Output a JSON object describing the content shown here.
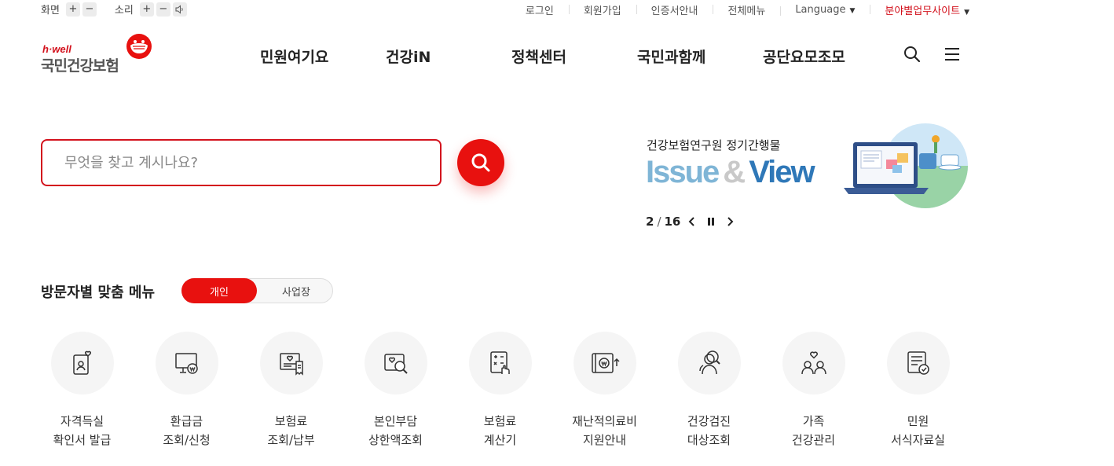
{
  "utility": {
    "screen_label": "화면",
    "sound_label": "소리",
    "plus": "+",
    "minus": "−",
    "links": [
      "로그인",
      "회원가입",
      "인증서안내",
      "전체메뉴",
      "Language"
    ],
    "site_link": "분야별업무사이트"
  },
  "logo": {
    "tagline": "h·well",
    "name": "국민건강보험"
  },
  "gnb": [
    "민원여기요",
    "건강iN",
    "정책센터",
    "국민과함께",
    "공단요모조모"
  ],
  "search": {
    "placeholder": "무엇을 찾고 계시나요?"
  },
  "banner": {
    "subtitle": "건강보험연구원 정기간행물",
    "title_part1": "Issue",
    "title_amp": "&",
    "title_part2": "View",
    "current": "2",
    "separator": "/",
    "total": "16",
    "colors": {
      "issue": "#7fb5d6",
      "view": "#2f78b8"
    }
  },
  "visitor_menu": {
    "title": "방문자별 맞춤 메뉴",
    "tabs": [
      "개인",
      "사업장"
    ],
    "active_tab": "개인",
    "items": [
      {
        "line1": "자격득실",
        "line2": "확인서 발급",
        "icon": "id-card-heart-icon"
      },
      {
        "line1": "환급금",
        "line2": "조회/신청",
        "icon": "monitor-won-icon"
      },
      {
        "line1": "보험료",
        "line2": "조회/납부",
        "icon": "bill-heart-icon"
      },
      {
        "line1": "본인부담",
        "line2": "상한액조회",
        "icon": "image-search-icon"
      },
      {
        "line1": "보험료",
        "line2": "계산기",
        "icon": "calculator-hand-icon"
      },
      {
        "line1": "재난적의료비",
        "line2": "지원안내",
        "icon": "wallet-won-up-icon"
      },
      {
        "line1": "건강검진",
        "line2": "대상조회",
        "icon": "person-search-icon"
      },
      {
        "line1": "가족",
        "line2": "건강관리",
        "icon": "family-heart-icon"
      },
      {
        "line1": "민원",
        "line2": "서식자료실",
        "icon": "document-check-icon"
      }
    ]
  },
  "colors": {
    "brand_red": "#e8110f",
    "link_red": "#d3121d"
  }
}
